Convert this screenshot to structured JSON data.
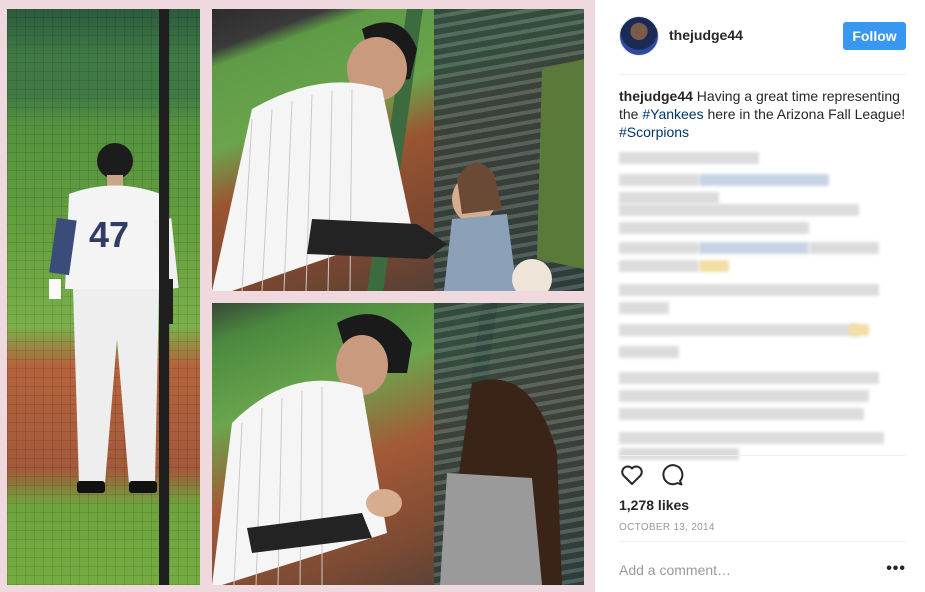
{
  "post": {
    "username": "thejudge44",
    "follow_label": "Follow",
    "caption": {
      "user": "thejudge44",
      "text_1": "Having a great time representing the",
      "hashtag_1": "#Yankees",
      "text_2": "here in the Arizona Fall League!",
      "hashtag_2": "#Scorpions"
    },
    "likes": "1,278 likes",
    "date": "OCTOBER 13, 2014",
    "comment_placeholder": "Add a comment…",
    "more_label": "•••"
  },
  "photo": {
    "jersey_number": "47"
  },
  "colors": {
    "accent": "#3897f0",
    "hashtag": "#003569",
    "muted": "#999999",
    "text": "#262626"
  },
  "icons": [
    "heart-icon",
    "comment-icon",
    "more-options-icon"
  ]
}
